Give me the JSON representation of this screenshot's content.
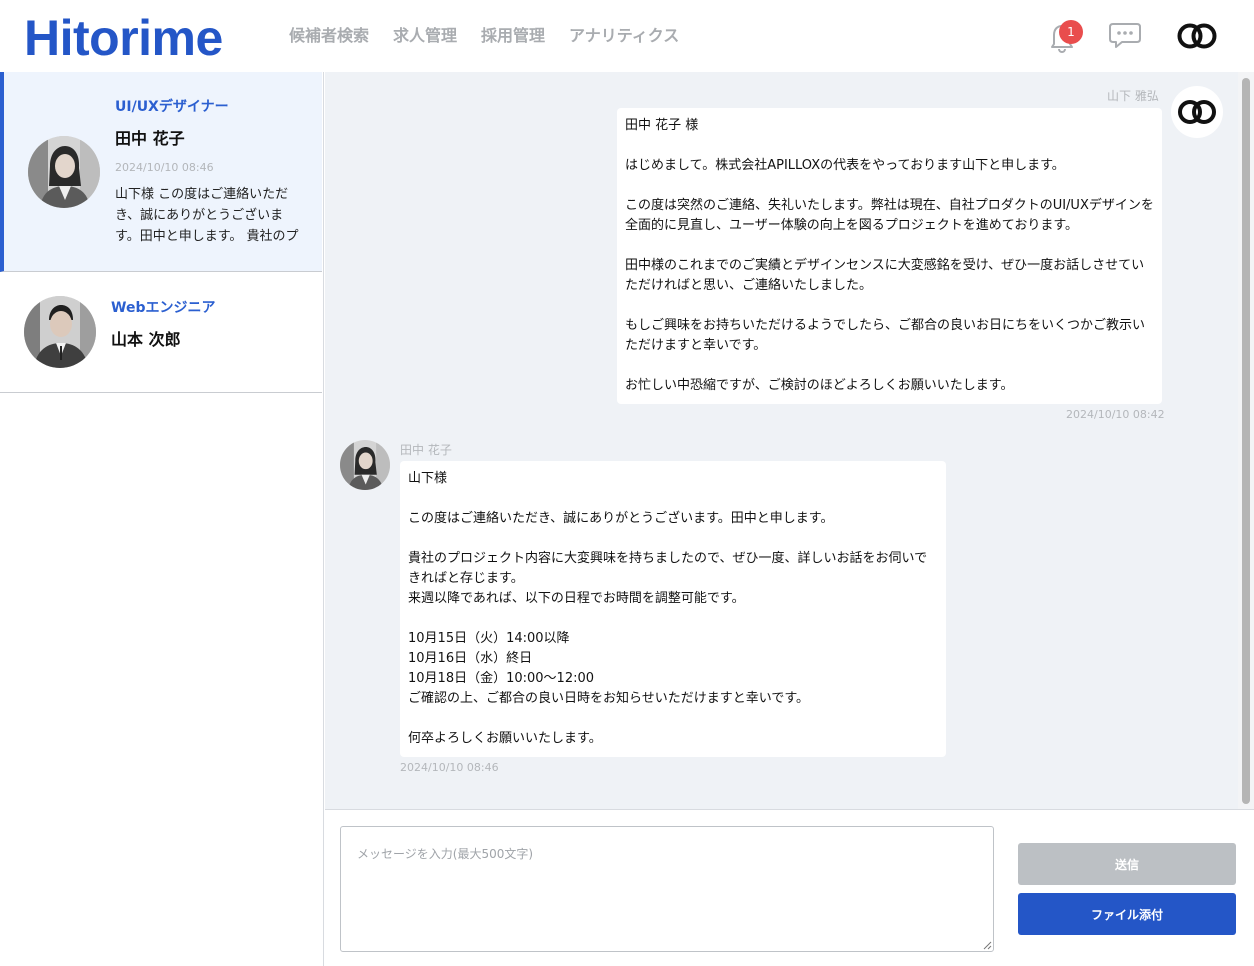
{
  "header": {
    "logo": "Hitorime",
    "nav": [
      "候補者検索",
      "求人管理",
      "採用管理",
      "アナリティクス"
    ],
    "notification_count": "1",
    "icons": [
      "bell-icon",
      "chat-bubble-icon",
      "brand-rings-icon"
    ]
  },
  "conversations": [
    {
      "role": "UI/UXデザイナー",
      "name": "田中 花子",
      "time": "2024/10/10 08:46",
      "preview": "山下様 この度はご連絡いただき、誠にありがとうございます。田中と申します。 貴社のプロジェクト内容に大変興味を持ちましたので、ぜひ一度、詳しいお話をお伺いできればと存じます。",
      "active": true
    },
    {
      "role": "Webエンジニア",
      "name": "山本 次郎",
      "active": false
    }
  ],
  "messages": [
    {
      "sender": "山下 雅弘",
      "direction": "outgoing",
      "body": "田中 花子 様\n\nはじめまして。株式会社APILLOXの代表をやっております山下と申します。\n\nこの度は突然のご連絡、失礼いたします。弊社は現在、自社プロダクトのUI/UXデザインを全面的に見直し、ユーザー体験の向上を図るプロジェクトを進めております。\n\n田中様のこれまでのご実績とデザインセンスに大変感銘を受け、ぜひ一度お話しさせていただければと思い、ご連絡いたしました。\n\nもしご興味をお持ちいただけるようでしたら、ご都合の良いお日にちをいくつかご教示いただけますと幸いです。\n\nお忙しい中恐縮ですが、ご検討のほどよろしくお願いいたします。",
      "time": "2024/10/10 08:42"
    },
    {
      "sender": "田中 花子",
      "direction": "incoming",
      "body": "山下様\n\nこの度はご連絡いただき、誠にありがとうございます。田中と申します。\n\n貴社のプロジェクト内容に大変興味を持ちましたので、ぜひ一度、詳しいお話をお伺いできればと存じます。\n来週以降であれば、以下の日程でお時間を調整可能です。\n\n10月15日（火）14:00以降\n10月16日（水）終日\n10月18日（金）10:00〜12:00\nご確認の上、ご都合の良い日時をお知らせいただけますと幸いです。\n\n何卒よろしくお願いいたします。",
      "time": "2024/10/10 08:46"
    }
  ],
  "composer": {
    "placeholder": "メッセージを入力(最大500文字)",
    "value": "",
    "send_label": "送信",
    "attach_label": "ファイル添付"
  },
  "colors": {
    "brand": "#2456c7",
    "active_bg": "#eef4fd",
    "chat_bg": "#eff2f6",
    "badge": "#e94d4d",
    "disabled": "#bcc0c4"
  }
}
